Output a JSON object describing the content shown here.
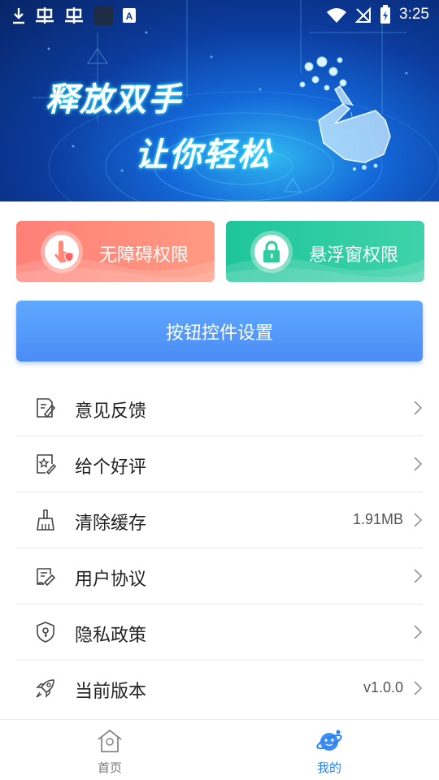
{
  "status_bar": {
    "time": "3:25",
    "left_icons": [
      "download-icon",
      "bug-icon",
      "bug-icon",
      "app-square-icon",
      "keyboard-a-icon"
    ],
    "right_icons": [
      "wifi-icon",
      "no-signal-icon",
      "battery-charging-icon"
    ]
  },
  "banner": {
    "line1": "释放双手",
    "line2": "让你轻松"
  },
  "permissions": {
    "accessibility": {
      "label": "无障碍权限",
      "icon": "touch-shield-icon",
      "color": "#ff8a7c"
    },
    "floating_window": {
      "label": "悬浮窗权限",
      "icon": "lock-icon",
      "color": "#2fcc9f"
    }
  },
  "main_button": {
    "label": "按钮控件设置",
    "color": "#4f93f8"
  },
  "menu": {
    "items": [
      {
        "label": "意见反馈",
        "value": "",
        "icon": "feedback-icon"
      },
      {
        "label": "给个好评",
        "value": "",
        "icon": "rate-star-icon"
      },
      {
        "label": "清除缓存",
        "value": "1.91MB",
        "icon": "broom-icon"
      },
      {
        "label": "用户协议",
        "value": "",
        "icon": "agreement-icon"
      },
      {
        "label": "隐私政策",
        "value": "",
        "icon": "privacy-shield-icon"
      },
      {
        "label": "当前版本",
        "value": "v1.0.0",
        "icon": "rocket-icon"
      }
    ]
  },
  "bottom_nav": {
    "home": {
      "label": "首页",
      "icon": "home-icon"
    },
    "mine": {
      "label": "我的",
      "icon": "planet-icon",
      "active_color": "#2a7ef0"
    }
  }
}
